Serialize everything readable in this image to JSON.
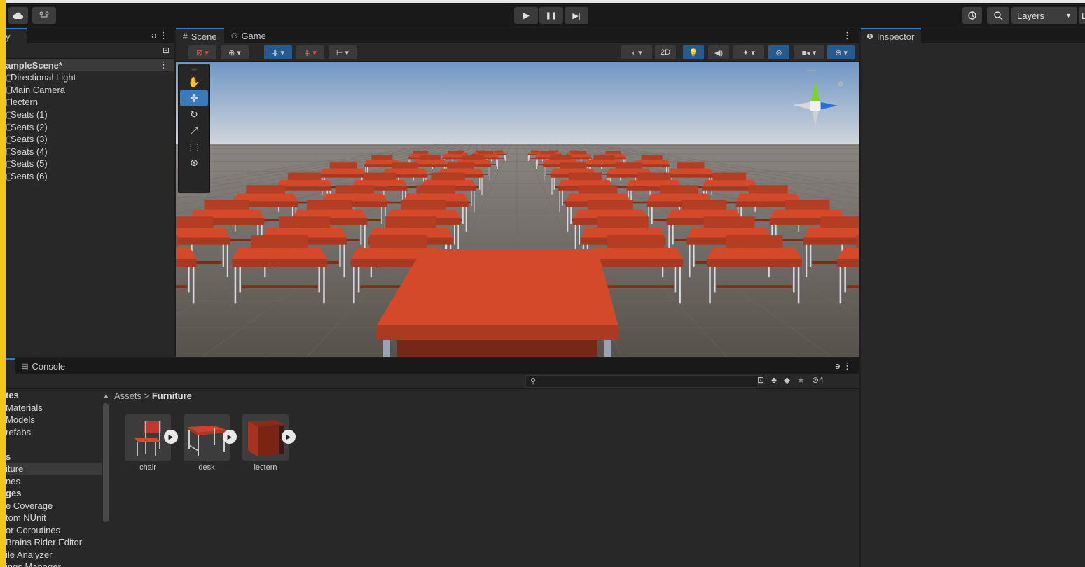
{
  "toolbar": {
    "cloud_icon": "cloud-icon",
    "collab_icon": "collab-icon",
    "play_icon": "▶",
    "pause_icon": "❚❚",
    "step_icon": "▶|",
    "history_icon": "history-icon",
    "search_icon": "search-icon",
    "layers_label": "Layers",
    "layout_label": "De"
  },
  "hierarchy": {
    "tab_label": "y",
    "scene_name": "ampleScene*",
    "items": [
      "Directional Light",
      "Main Camera",
      "lectern",
      "Seats (1)",
      "Seats (2)",
      "Seats (3)",
      "Seats (4)",
      "Seats (5)",
      "Seats (6)"
    ]
  },
  "scene": {
    "tab_scene": "Scene",
    "tab_game": "Game",
    "mode_2d": "2D"
  },
  "inspector": {
    "tab_label": "Inspector"
  },
  "console": {
    "tab_label": "Console"
  },
  "project": {
    "breadcrumb_root": "Assets",
    "breadcrumb_sep": ">",
    "breadcrumb_current": "Furniture",
    "hidden_count": "4",
    "folders": [
      {
        "label": "tes",
        "bold": true
      },
      {
        "label": "Materials",
        "bold": false
      },
      {
        "label": "Models",
        "bold": false
      },
      {
        "label": "refabs",
        "bold": false
      },
      {
        "label": "",
        "bold": false
      },
      {
        "label": "s",
        "bold": true
      },
      {
        "label": "iture",
        "bold": false,
        "selected": true
      },
      {
        "label": "nes",
        "bold": false
      },
      {
        "label": "ges",
        "bold": true
      },
      {
        "label": "e Coverage",
        "bold": false
      },
      {
        "label": "tom NUnit",
        "bold": false
      },
      {
        "label": "or Coroutines",
        "bold": false
      },
      {
        "label": "Brains Rider Editor",
        "bold": false
      },
      {
        "label": "ile Analyzer",
        "bold": false
      },
      {
        "label": "ings Manager",
        "bold": false
      }
    ],
    "assets": [
      {
        "name": "chair"
      },
      {
        "name": "desk"
      },
      {
        "name": "lectern"
      }
    ]
  },
  "colors": {
    "accent": "#3a79bb",
    "furniture_red": "#d4492a",
    "sky_top": "#6f93c0",
    "ground": "#5b5550"
  }
}
